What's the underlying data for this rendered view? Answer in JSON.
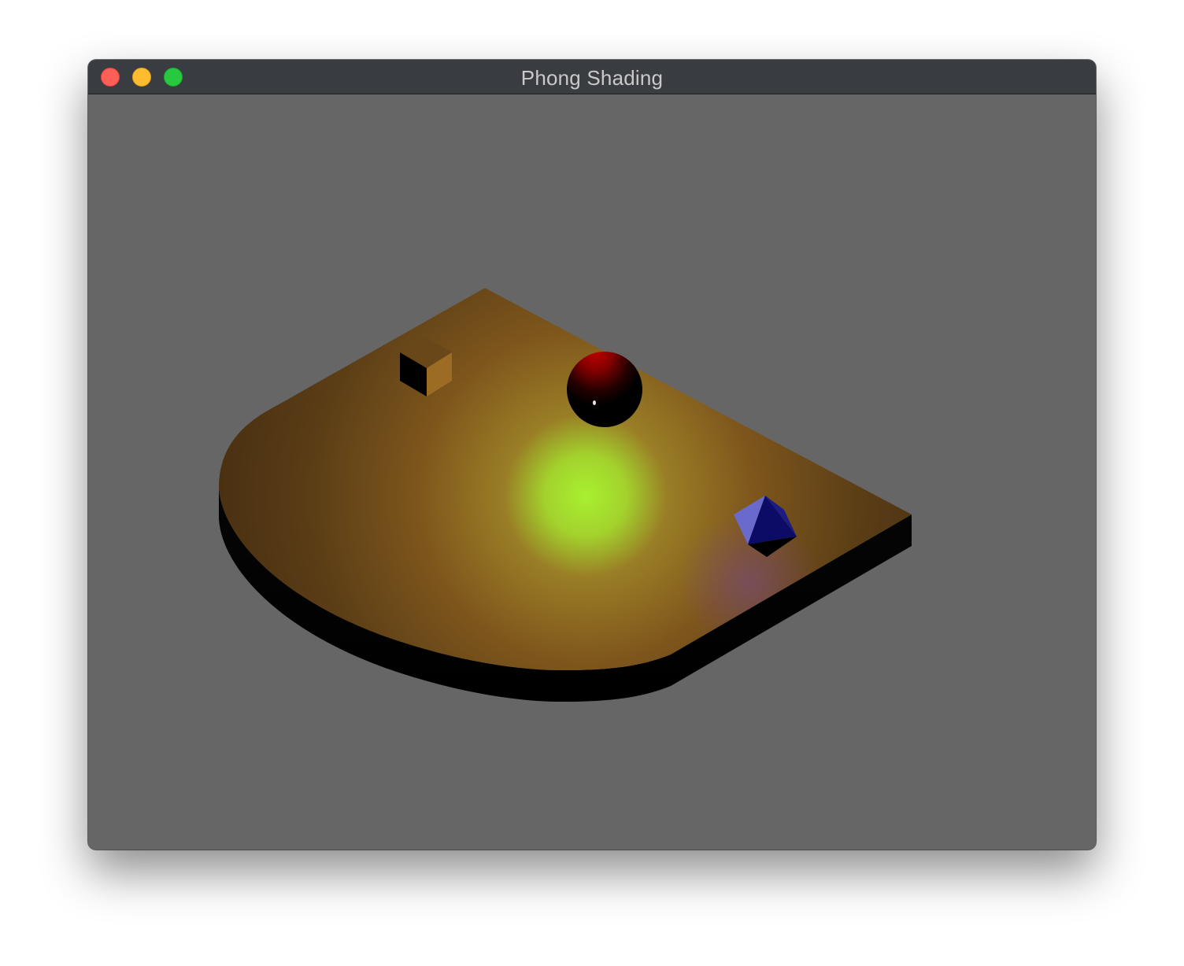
{
  "window": {
    "title": "Phong Shading",
    "buttons": {
      "close": "close-button",
      "minimize": "minimize-button",
      "zoom": "zoom-button"
    }
  },
  "scene": {
    "background_color": "#666666",
    "objects": [
      {
        "name": "platform",
        "color": "#8a5f20"
      },
      {
        "name": "cube",
        "color": "#8a6020"
      },
      {
        "name": "sphere",
        "color": "#c00000"
      },
      {
        "name": "octahedron",
        "color": "#2a2aa0"
      }
    ],
    "highlight_color": "#a8f030"
  }
}
